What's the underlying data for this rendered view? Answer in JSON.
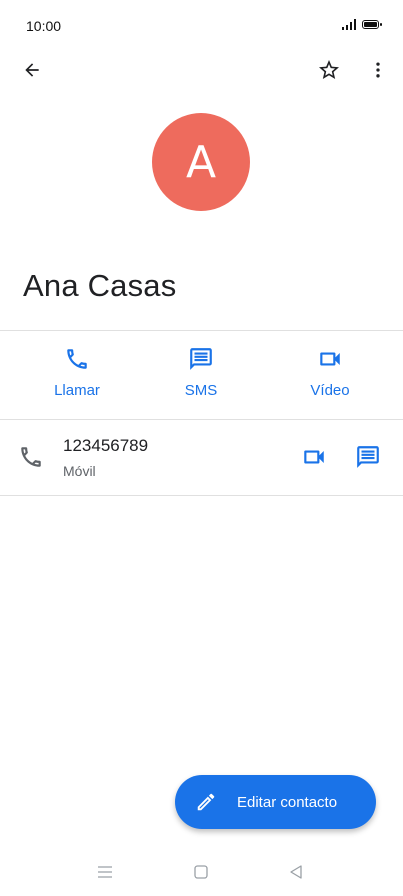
{
  "status_bar": {
    "time": "10:00"
  },
  "contact": {
    "avatar_letter": "A",
    "name": "Ana Casas"
  },
  "actions": [
    {
      "label": "Llamar",
      "icon": "phone-icon"
    },
    {
      "label": "SMS",
      "icon": "message-icon"
    },
    {
      "label": "Vídeo",
      "icon": "video-icon"
    }
  ],
  "phone": {
    "number": "123456789",
    "type": "Móvil"
  },
  "fab": {
    "label": "Editar contacto",
    "icon": "pencil-icon"
  },
  "colors": {
    "accent": "#1a73e8",
    "avatar": "#ee6b5d"
  }
}
